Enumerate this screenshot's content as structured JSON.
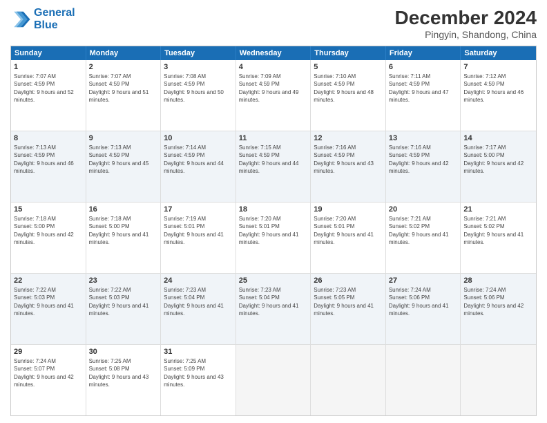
{
  "logo": {
    "line1": "General",
    "line2": "Blue"
  },
  "title": "December 2024",
  "subtitle": "Pingyin, Shandong, China",
  "weekdays": [
    "Sunday",
    "Monday",
    "Tuesday",
    "Wednesday",
    "Thursday",
    "Friday",
    "Saturday"
  ],
  "weeks": [
    [
      {
        "day": "1",
        "sunrise": "Sunrise: 7:07 AM",
        "sunset": "Sunset: 4:59 PM",
        "daylight": "Daylight: 9 hours and 52 minutes."
      },
      {
        "day": "2",
        "sunrise": "Sunrise: 7:07 AM",
        "sunset": "Sunset: 4:59 PM",
        "daylight": "Daylight: 9 hours and 51 minutes."
      },
      {
        "day": "3",
        "sunrise": "Sunrise: 7:08 AM",
        "sunset": "Sunset: 4:59 PM",
        "daylight": "Daylight: 9 hours and 50 minutes."
      },
      {
        "day": "4",
        "sunrise": "Sunrise: 7:09 AM",
        "sunset": "Sunset: 4:59 PM",
        "daylight": "Daylight: 9 hours and 49 minutes."
      },
      {
        "day": "5",
        "sunrise": "Sunrise: 7:10 AM",
        "sunset": "Sunset: 4:59 PM",
        "daylight": "Daylight: 9 hours and 48 minutes."
      },
      {
        "day": "6",
        "sunrise": "Sunrise: 7:11 AM",
        "sunset": "Sunset: 4:59 PM",
        "daylight": "Daylight: 9 hours and 47 minutes."
      },
      {
        "day": "7",
        "sunrise": "Sunrise: 7:12 AM",
        "sunset": "Sunset: 4:59 PM",
        "daylight": "Daylight: 9 hours and 46 minutes."
      }
    ],
    [
      {
        "day": "8",
        "sunrise": "Sunrise: 7:13 AM",
        "sunset": "Sunset: 4:59 PM",
        "daylight": "Daylight: 9 hours and 46 minutes."
      },
      {
        "day": "9",
        "sunrise": "Sunrise: 7:13 AM",
        "sunset": "Sunset: 4:59 PM",
        "daylight": "Daylight: 9 hours and 45 minutes."
      },
      {
        "day": "10",
        "sunrise": "Sunrise: 7:14 AM",
        "sunset": "Sunset: 4:59 PM",
        "daylight": "Daylight: 9 hours and 44 minutes."
      },
      {
        "day": "11",
        "sunrise": "Sunrise: 7:15 AM",
        "sunset": "Sunset: 4:59 PM",
        "daylight": "Daylight: 9 hours and 44 minutes."
      },
      {
        "day": "12",
        "sunrise": "Sunrise: 7:16 AM",
        "sunset": "Sunset: 4:59 PM",
        "daylight": "Daylight: 9 hours and 43 minutes."
      },
      {
        "day": "13",
        "sunrise": "Sunrise: 7:16 AM",
        "sunset": "Sunset: 4:59 PM",
        "daylight": "Daylight: 9 hours and 42 minutes."
      },
      {
        "day": "14",
        "sunrise": "Sunrise: 7:17 AM",
        "sunset": "Sunset: 5:00 PM",
        "daylight": "Daylight: 9 hours and 42 minutes."
      }
    ],
    [
      {
        "day": "15",
        "sunrise": "Sunrise: 7:18 AM",
        "sunset": "Sunset: 5:00 PM",
        "daylight": "Daylight: 9 hours and 42 minutes."
      },
      {
        "day": "16",
        "sunrise": "Sunrise: 7:18 AM",
        "sunset": "Sunset: 5:00 PM",
        "daylight": "Daylight: 9 hours and 41 minutes."
      },
      {
        "day": "17",
        "sunrise": "Sunrise: 7:19 AM",
        "sunset": "Sunset: 5:01 PM",
        "daylight": "Daylight: 9 hours and 41 minutes."
      },
      {
        "day": "18",
        "sunrise": "Sunrise: 7:20 AM",
        "sunset": "Sunset: 5:01 PM",
        "daylight": "Daylight: 9 hours and 41 minutes."
      },
      {
        "day": "19",
        "sunrise": "Sunrise: 7:20 AM",
        "sunset": "Sunset: 5:01 PM",
        "daylight": "Daylight: 9 hours and 41 minutes."
      },
      {
        "day": "20",
        "sunrise": "Sunrise: 7:21 AM",
        "sunset": "Sunset: 5:02 PM",
        "daylight": "Daylight: 9 hours and 41 minutes."
      },
      {
        "day": "21",
        "sunrise": "Sunrise: 7:21 AM",
        "sunset": "Sunset: 5:02 PM",
        "daylight": "Daylight: 9 hours and 41 minutes."
      }
    ],
    [
      {
        "day": "22",
        "sunrise": "Sunrise: 7:22 AM",
        "sunset": "Sunset: 5:03 PM",
        "daylight": "Daylight: 9 hours and 41 minutes."
      },
      {
        "day": "23",
        "sunrise": "Sunrise: 7:22 AM",
        "sunset": "Sunset: 5:03 PM",
        "daylight": "Daylight: 9 hours and 41 minutes."
      },
      {
        "day": "24",
        "sunrise": "Sunrise: 7:23 AM",
        "sunset": "Sunset: 5:04 PM",
        "daylight": "Daylight: 9 hours and 41 minutes."
      },
      {
        "day": "25",
        "sunrise": "Sunrise: 7:23 AM",
        "sunset": "Sunset: 5:04 PM",
        "daylight": "Daylight: 9 hours and 41 minutes."
      },
      {
        "day": "26",
        "sunrise": "Sunrise: 7:23 AM",
        "sunset": "Sunset: 5:05 PM",
        "daylight": "Daylight: 9 hours and 41 minutes."
      },
      {
        "day": "27",
        "sunrise": "Sunrise: 7:24 AM",
        "sunset": "Sunset: 5:06 PM",
        "daylight": "Daylight: 9 hours and 41 minutes."
      },
      {
        "day": "28",
        "sunrise": "Sunrise: 7:24 AM",
        "sunset": "Sunset: 5:06 PM",
        "daylight": "Daylight: 9 hours and 42 minutes."
      }
    ],
    [
      {
        "day": "29",
        "sunrise": "Sunrise: 7:24 AM",
        "sunset": "Sunset: 5:07 PM",
        "daylight": "Daylight: 9 hours and 42 minutes."
      },
      {
        "day": "30",
        "sunrise": "Sunrise: 7:25 AM",
        "sunset": "Sunset: 5:08 PM",
        "daylight": "Daylight: 9 hours and 43 minutes."
      },
      {
        "day": "31",
        "sunrise": "Sunrise: 7:25 AM",
        "sunset": "Sunset: 5:09 PM",
        "daylight": "Daylight: 9 hours and 43 minutes."
      },
      null,
      null,
      null,
      null
    ]
  ]
}
